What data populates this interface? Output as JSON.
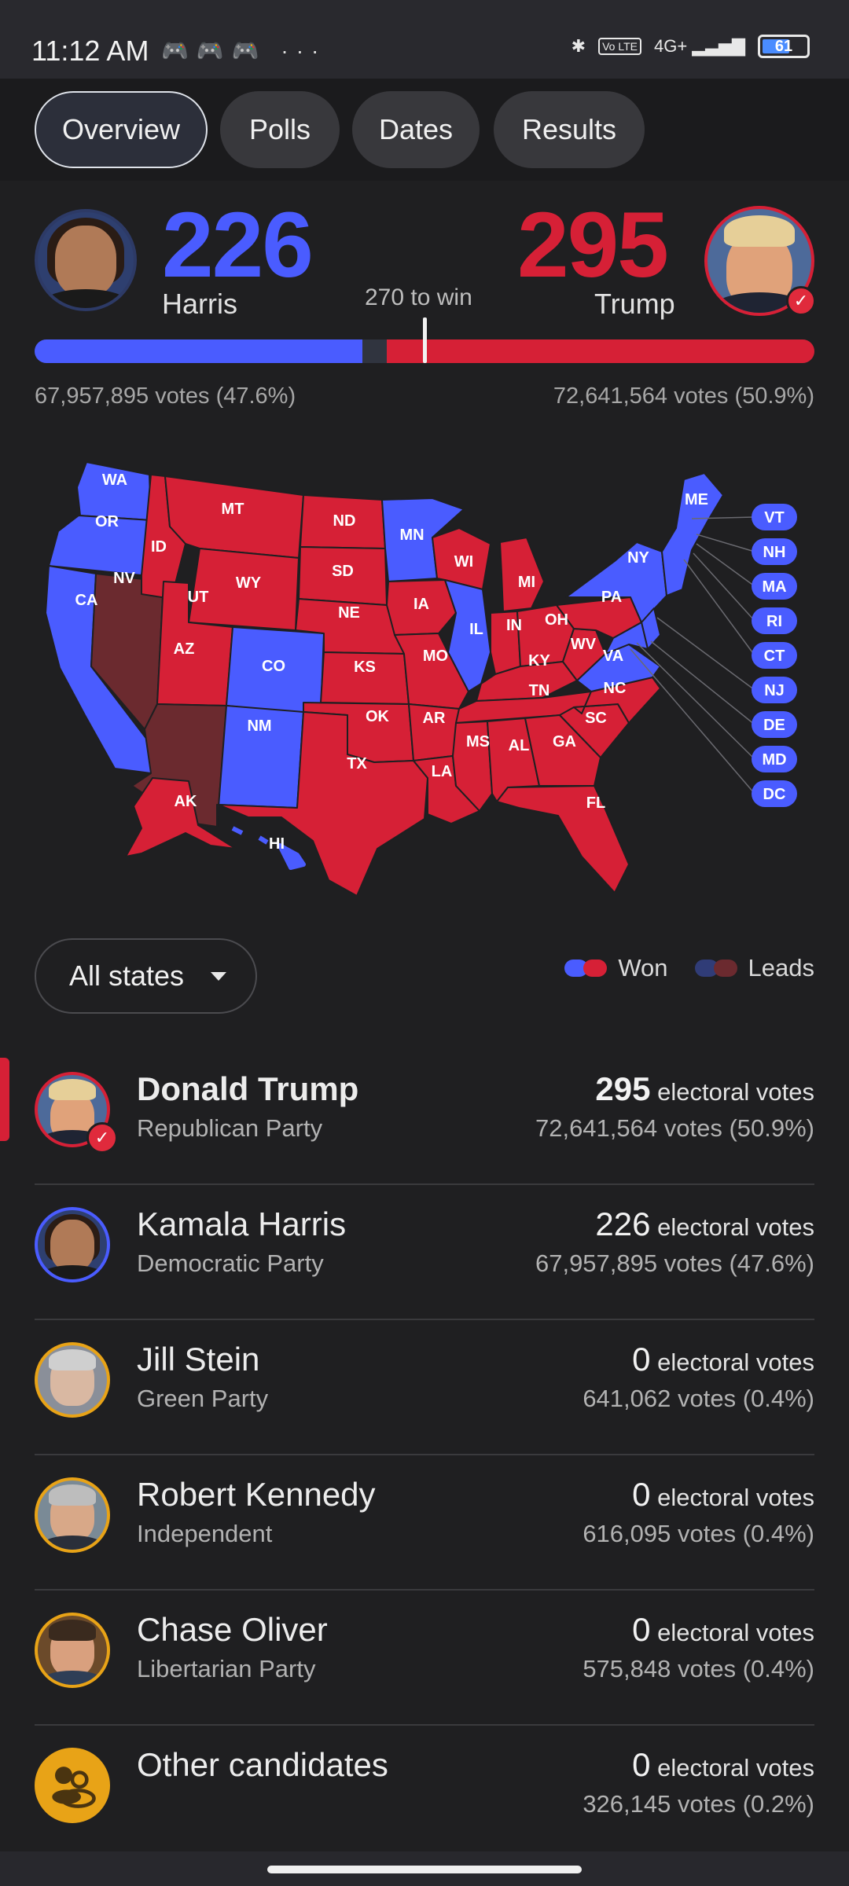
{
  "status_bar": {
    "time": "11:12 AM",
    "more": "···",
    "network": "4G+",
    "volte": "Vo LTE",
    "battery": "61"
  },
  "tabs": [
    {
      "label": "Overview",
      "active": true
    },
    {
      "label": "Polls",
      "active": false
    },
    {
      "label": "Dates",
      "active": false
    },
    {
      "label": "Results",
      "active": false
    }
  ],
  "scoreboard": {
    "harris": {
      "name": "Harris",
      "electoral": "226",
      "votes": "67,957,895 votes (47.6%)",
      "color": "#4a5cff",
      "share_of_538": 0.42
    },
    "trump": {
      "name": "Trump",
      "electoral": "295",
      "votes": "72,641,564 votes (50.9%)",
      "color": "#d62036",
      "share_of_538": 0.548
    },
    "to_win": "270 to win"
  },
  "map": {
    "colors": {
      "dem_won": "#4a5cff",
      "rep_won": "#d62036",
      "rep_leads": "#6b2a2f",
      "dem_leads": "#303c77"
    },
    "states": [
      "WA",
      "OR",
      "CA",
      "NV",
      "ID",
      "MT",
      "WY",
      "UT",
      "AZ",
      "CO",
      "NM",
      "ND",
      "SD",
      "NE",
      "KS",
      "OK",
      "TX",
      "MN",
      "IA",
      "MO",
      "AR",
      "LA",
      "WI",
      "IL",
      "MI",
      "IN",
      "OH",
      "KY",
      "TN",
      "MS",
      "AL",
      "GA",
      "FL",
      "SC",
      "NC",
      "VA",
      "WV",
      "PA",
      "NY",
      "ME",
      "AK",
      "HI"
    ],
    "small_states": [
      "VT",
      "NH",
      "MA",
      "RI",
      "CT",
      "NJ",
      "DE",
      "MD",
      "DC"
    ]
  },
  "filter": {
    "label": "All states"
  },
  "legend": {
    "won": "Won",
    "leads": "Leads"
  },
  "electoral_label": "electoral votes",
  "candidates": [
    {
      "name": "Donald Trump",
      "party": "Republican Party",
      "electoral": "295",
      "votes": "72,641,564 votes (50.9%)",
      "ring": "#d62036"
    },
    {
      "name": "Kamala Harris",
      "party": "Democratic Party",
      "electoral": "226",
      "votes": "67,957,895 votes (47.6%)",
      "ring": "#4a5cff"
    },
    {
      "name": "Jill Stein",
      "party": "Green Party",
      "electoral": "0",
      "votes": "641,062 votes (0.4%)",
      "ring": "#e8a317"
    },
    {
      "name": "Robert Kennedy",
      "party": "Independent",
      "electoral": "0",
      "votes": "616,095 votes (0.4%)",
      "ring": "#e8a317"
    },
    {
      "name": "Chase Oliver",
      "party": "Libertarian Party",
      "electoral": "0",
      "votes": "575,848 votes (0.4%)",
      "ring": "#e8a317"
    },
    {
      "name": "Other candidates",
      "party": "",
      "electoral": "0",
      "votes": "326,145 votes (0.2%)",
      "ring": "#e8a317"
    }
  ]
}
